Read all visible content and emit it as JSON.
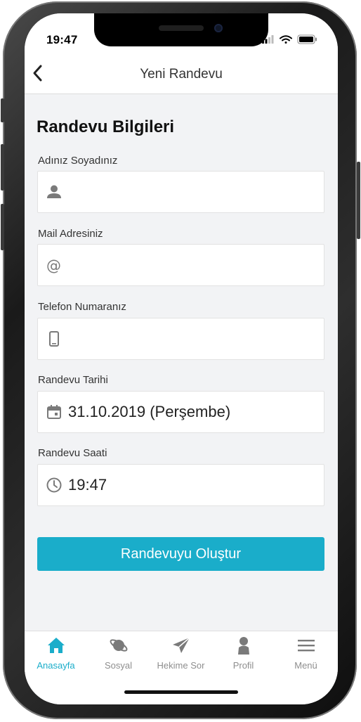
{
  "status_bar": {
    "time": "19:47"
  },
  "header": {
    "title": "Yeni Randevu",
    "back_icon": "chevron-left-icon"
  },
  "form": {
    "section_title": "Randevu Bilgileri",
    "fields": [
      {
        "label": "Adınız Soyadınız",
        "icon": "person-icon",
        "value": ""
      },
      {
        "label": "Mail Adresiniz",
        "icon": "at-icon",
        "value": ""
      },
      {
        "label": "Telefon Numaranız",
        "icon": "phone-icon",
        "value": ""
      },
      {
        "label": "Randevu Tarihi",
        "icon": "calendar-icon",
        "value": "31.10.2019 (Perşembe)"
      },
      {
        "label": "Randevu Saati",
        "icon": "clock-icon",
        "value": "19:47"
      }
    ],
    "submit_label": "Randevuyu Oluştur"
  },
  "tab_bar": {
    "items": [
      {
        "label": "Anasayfa",
        "icon": "home-icon",
        "active": true
      },
      {
        "label": "Sosyal",
        "icon": "planet-icon",
        "active": false
      },
      {
        "label": "Hekime Sor",
        "icon": "paper-plane-icon",
        "active": false
      },
      {
        "label": "Profil",
        "icon": "user-icon",
        "active": false
      },
      {
        "label": "Menü",
        "icon": "menu-icon",
        "active": false
      }
    ]
  },
  "colors": {
    "accent": "#1aadca",
    "background": "#f2f3f5",
    "icon_gray": "#7a7a7a"
  }
}
